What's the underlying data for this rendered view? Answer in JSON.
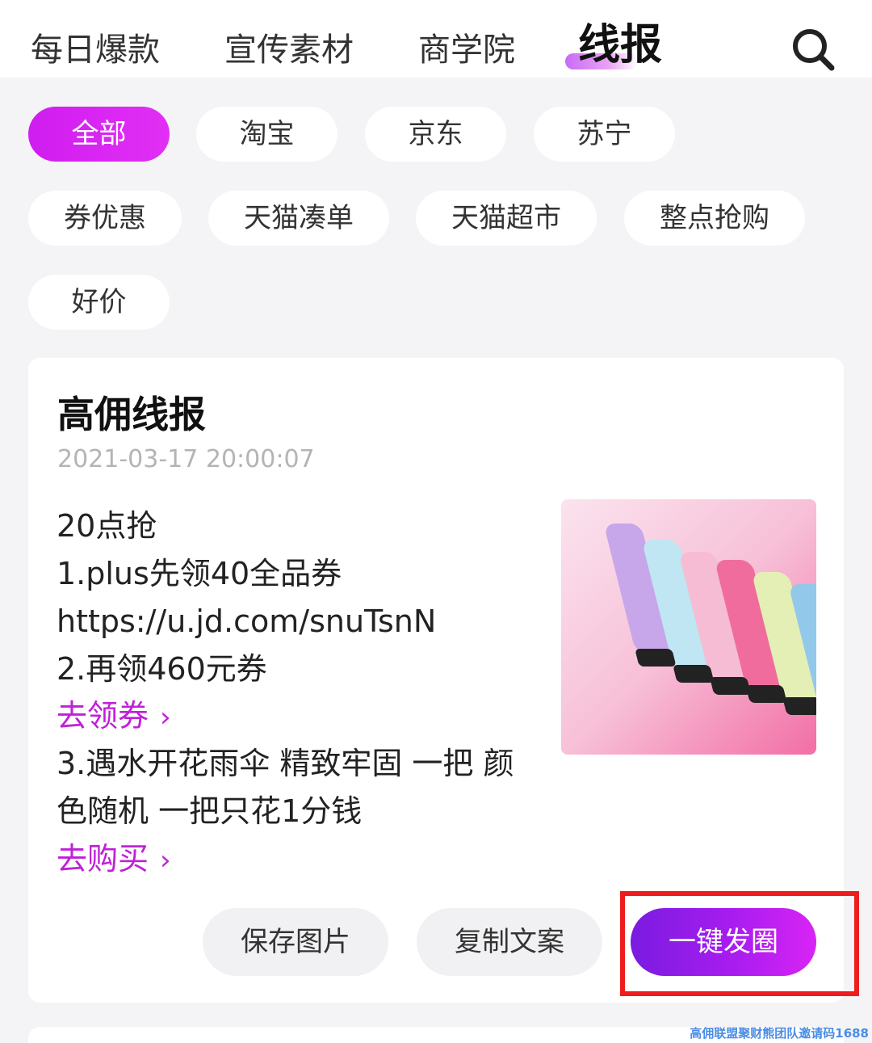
{
  "tabs": [
    {
      "label": "每日爆款"
    },
    {
      "label": "宣传素材"
    },
    {
      "label": "商学院"
    },
    {
      "label": "线报",
      "active": true
    }
  ],
  "search": {
    "icon": "search-icon"
  },
  "filters": [
    {
      "label": "全部",
      "active": true
    },
    {
      "label": "淘宝"
    },
    {
      "label": "京东"
    },
    {
      "label": "苏宁"
    },
    {
      "label": "券优惠"
    },
    {
      "label": "天猫凑单"
    },
    {
      "label": "天猫超市"
    },
    {
      "label": "整点抢购"
    },
    {
      "label": "好价"
    }
  ],
  "card": {
    "title": "高佣线报",
    "time": "2021-03-17 20:00:07",
    "lines": [
      "20点抢",
      "1.plus先领40全品券",
      "https://u.jd.com/snuTsnN",
      "2.再领460元券"
    ],
    "link1": "去领券",
    "lines2": [
      "3.遇水开花雨伞 精致牢固 一把 颜",
      "色随机 一把只花1分钱"
    ],
    "link2": "去购买",
    "chevron": "›",
    "actions": {
      "save": "保存图片",
      "copy": "复制文案",
      "share": "一键发圈"
    }
  },
  "colors": {
    "accent": "#d01df0",
    "link": "#c020d8",
    "primary_gradient_start": "#7a1be0",
    "highlight": "#ee1c1c"
  },
  "watermark": "高佣联盟聚财熊团队邀请码1688"
}
